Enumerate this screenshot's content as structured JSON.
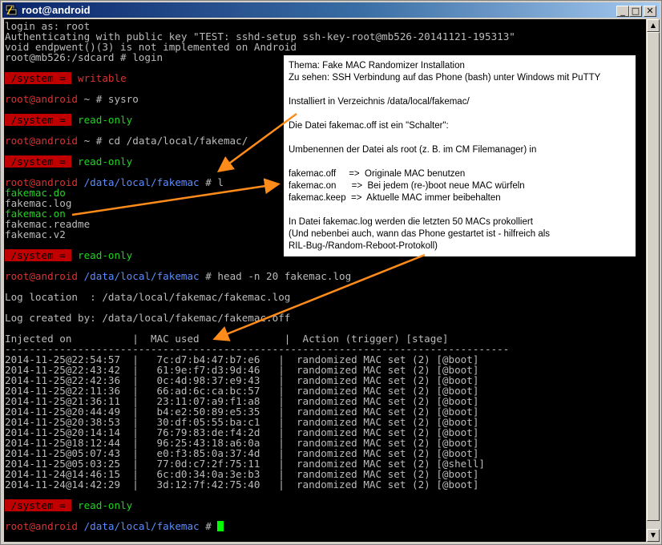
{
  "window": {
    "title": "root@android",
    "buttons": {
      "minimize": "_",
      "maximize": "□",
      "close": "✕"
    }
  },
  "terminal": {
    "lines": [
      {
        "parts": [
          {
            "t": "login as: root",
            "c": "gray"
          }
        ]
      },
      {
        "parts": [
          {
            "t": "Authenticating with public key \"TEST: sshd-setup ssh-key-root@mb526-20141121-195313\"",
            "c": "gray"
          }
        ]
      },
      {
        "parts": [
          {
            "t": "void endpwent()(3) is not implemented on Android",
            "c": "gray"
          }
        ]
      },
      {
        "parts": [
          {
            "t": "root@mb526:/sdcard # login",
            "c": "gray"
          }
        ]
      },
      {
        "parts": []
      },
      {
        "parts": [
          {
            "t": " /system = ",
            "c": "red-bg"
          },
          {
            "t": " writable",
            "c": "red"
          }
        ]
      },
      {
        "parts": []
      },
      {
        "parts": [
          {
            "t": "root@android",
            "c": "red"
          },
          {
            "t": " ~ # sysro",
            "c": "gray"
          }
        ]
      },
      {
        "parts": []
      },
      {
        "parts": [
          {
            "t": " /system = ",
            "c": "red-bg"
          },
          {
            "t": " read-only",
            "c": "green"
          }
        ]
      },
      {
        "parts": []
      },
      {
        "parts": [
          {
            "t": "root@android",
            "c": "red"
          },
          {
            "t": " ~ # cd /data/local/fakemac/",
            "c": "gray"
          }
        ]
      },
      {
        "parts": []
      },
      {
        "parts": [
          {
            "t": " /system = ",
            "c": "red-bg"
          },
          {
            "t": " read-only",
            "c": "green"
          }
        ]
      },
      {
        "parts": []
      },
      {
        "parts": [
          {
            "t": "root@android",
            "c": "red"
          },
          {
            "t": " /data/local/fakemac",
            "c": "blue"
          },
          {
            "t": " # l",
            "c": "gray"
          }
        ]
      },
      {
        "parts": [
          {
            "t": "fakemac.do",
            "c": "green"
          }
        ]
      },
      {
        "parts": [
          {
            "t": "fakemac.log",
            "c": "gray"
          }
        ]
      },
      {
        "parts": [
          {
            "t": "fakemac.on",
            "c": "green"
          }
        ]
      },
      {
        "parts": [
          {
            "t": "fakemac.readme",
            "c": "gray"
          }
        ]
      },
      {
        "parts": [
          {
            "t": "fakemac.v2",
            "c": "gray"
          }
        ]
      },
      {
        "parts": []
      },
      {
        "parts": [
          {
            "t": " /system = ",
            "c": "red-bg"
          },
          {
            "t": " read-only",
            "c": "green"
          }
        ]
      },
      {
        "parts": []
      },
      {
        "parts": [
          {
            "t": "root@android",
            "c": "red"
          },
          {
            "t": " /data/local/fakemac",
            "c": "blue"
          },
          {
            "t": " # head -n 20 fakemac.log",
            "c": "gray"
          }
        ]
      },
      {
        "parts": []
      },
      {
        "parts": [
          {
            "t": "Log location  : /data/local/fakemac/fakemac.log",
            "c": "gray"
          }
        ]
      },
      {
        "parts": []
      },
      {
        "parts": [
          {
            "t": "Log created by: /data/local/fakemac/fakemac.off",
            "c": "gray"
          }
        ]
      },
      {
        "parts": []
      },
      {
        "parts": [
          {
            "t": "Injected on          |  MAC used              |  Action (trigger) [stage]",
            "c": "gray"
          }
        ]
      },
      {
        "parts": [
          {
            "t": "-----------------------------------------------------------------------------------",
            "c": "gray"
          }
        ]
      },
      {
        "parts": [
          {
            "t": "2014-11-25@22:54:57  |   7c:d7:b4:47:b7:e6   |  randomized MAC set (2) [@boot]",
            "c": "gray"
          }
        ]
      },
      {
        "parts": [
          {
            "t": "2014-11-25@22:43:42  |   61:9e:f7:d3:9d:46   |  randomized MAC set (2) [@boot]",
            "c": "gray"
          }
        ]
      },
      {
        "parts": [
          {
            "t": "2014-11-25@22:42:36  |   0c:4d:98:37:e9:43   |  randomized MAC set (2) [@boot]",
            "c": "gray"
          }
        ]
      },
      {
        "parts": [
          {
            "t": "2014-11-25@22:11:36  |   66:ad:6c:ca:bc:57   |  randomized MAC set (2) [@boot]",
            "c": "gray"
          }
        ]
      },
      {
        "parts": [
          {
            "t": "2014-11-25@21:36:11  |   23:11:07:a9:f1:a8   |  randomized MAC set (2) [@boot]",
            "c": "gray"
          }
        ]
      },
      {
        "parts": [
          {
            "t": "2014-11-25@20:44:49  |   b4:e2:50:89:e5:35   |  randomized MAC set (2) [@boot]",
            "c": "gray"
          }
        ]
      },
      {
        "parts": [
          {
            "t": "2014-11-25@20:38:53  |   30:df:05:55:ba:c1   |  randomized MAC set (2) [@boot]",
            "c": "gray"
          }
        ]
      },
      {
        "parts": [
          {
            "t": "2014-11-25@20:14:14  |   76:79:83:de:f4:2d   |  randomized MAC set (2) [@boot]",
            "c": "gray"
          }
        ]
      },
      {
        "parts": [
          {
            "t": "2014-11-25@18:12:44  |   96:25:43:18:a6:0a   |  randomized MAC set (2) [@boot]",
            "c": "gray"
          }
        ]
      },
      {
        "parts": [
          {
            "t": "2014-11-25@05:07:43  |   e0:f3:85:0a:37:4d   |  randomized MAC set (2) [@boot]",
            "c": "gray"
          }
        ]
      },
      {
        "parts": [
          {
            "t": "2014-11-25@05:03:25  |   77:0d:c7:2f:75:11   |  randomized MAC set (2) [@shell]",
            "c": "gray"
          }
        ]
      },
      {
        "parts": [
          {
            "t": "2014-11-24@14:46:15  |   6c:d0:34:0a:3e:b3   |  randomized MAC set (2) [@boot]",
            "c": "gray"
          }
        ]
      },
      {
        "parts": [
          {
            "t": "2014-11-24@14:42:29  |   3d:12:7f:42:75:40   |  randomized MAC set (2) [@boot]",
            "c": "gray"
          }
        ]
      },
      {
        "parts": []
      },
      {
        "parts": [
          {
            "t": " /system = ",
            "c": "red-bg"
          },
          {
            "t": " read-only",
            "c": "green"
          }
        ]
      },
      {
        "parts": []
      },
      {
        "parts": [
          {
            "t": "root@android",
            "c": "red"
          },
          {
            "t": " /data/local/fakemac",
            "c": "blue"
          },
          {
            "t": " # ",
            "c": "gray"
          },
          {
            "cursor": true
          }
        ]
      }
    ]
  },
  "note": {
    "lines": [
      "Thema: Fake MAC Randomizer Installation",
      "Zu sehen: SSH Verbindung auf das Phone (bash) unter Windows mit PuTTY",
      "",
      "Installiert in Verzeichnis /data/local/fakemac/",
      "",
      "Die Datei fakemac.off ist ein \"Schalter\":",
      "",
      "Umbenennen der Datei als root (z. B. im CM Filemanager) in",
      "",
      "fakemac.off     =>  Originale MAC benutzen",
      "fakemac.on      =>  Bei jedem (re-)boot neue MAC würfeln",
      "fakemac.keep  =>  Aktuelle MAC immer beibehalten",
      "",
      "In Datei fakemac.log werden die letzten 50 MACs prokolliert",
      "(Und nebenbei auch, wann das Phone gestartet ist - hilfreich als",
      "RIL-Bug-/Random-Reboot-Protokoll)"
    ]
  },
  "colors": {
    "arrow": "#ff8c1a",
    "terminal_bg": "#000000",
    "prompt_red": "#e03030",
    "path_blue": "#5c8cff",
    "ok_green": "#22d222"
  }
}
